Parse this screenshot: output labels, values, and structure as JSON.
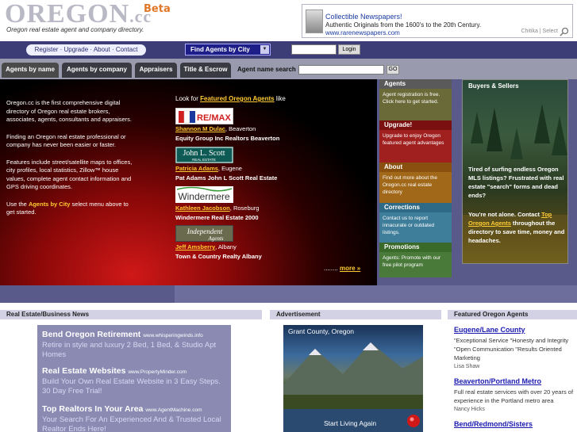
{
  "header": {
    "logo_main": "OREGON",
    "logo_cc": ".cc",
    "beta": "Beta",
    "tagline": "Oregon real estate agent and company directory."
  },
  "top_ad": {
    "title": "Collectible Newspapers!",
    "line": "Authentic Originals from the 1600's to the 20th Century.",
    "url": "www.rarenewspapers.com",
    "chitika": "Chitika | Select"
  },
  "nav": {
    "register": "Register",
    "upgrade": "Upgrade",
    "about": "About",
    "contact": "Contact",
    "sep": " · ",
    "city_select": "Find Agents by City",
    "login_btn": "Login"
  },
  "tabs": {
    "by_name": "Agents by name",
    "by_company": "Agents by company",
    "appraisers": "Appraisers",
    "title_escrow": "Title & Escrow",
    "search_label": "Agent name search",
    "go": "GO"
  },
  "hero": {
    "p1": "Oregon.cc is the first comprehensive digital directory of Oregon real estate brokers, associates, agents, consultants and appraisers.",
    "p2": "Finding an Oregon real estate professional or company has never been easier or faster.",
    "p3": "Features include street/satellite maps to offices, city profiles, local statistics, Zillow™ house values, complete agent contact information and GPS driving coordinates.",
    "p4_pre": "Use the ",
    "p4_hl": "Agents by City",
    "p4_post": " select menu above to get started.",
    "featured_pre": "Look for ",
    "featured_link": "Featured Oregon Agents",
    "featured_post": " like",
    "more_dots": "........ ",
    "more": "more »",
    "agents": [
      {
        "logo": "RE/MAX",
        "name": "Shannon M Dulac",
        "city": ", Beaverton",
        "company": "Equity Group Inc Realtors Beaverton"
      },
      {
        "logo": "John L. Scott",
        "logo_sub": "REAL ESTATE",
        "name": "Patricia Adams",
        "city": ", Eugene",
        "company": "Pat Adams John L Scott Real Estate"
      },
      {
        "logo": "Windermere",
        "name": "Kathleen Jacobson",
        "city": ", Roseburg",
        "company": "Windermere Real Estate 2000"
      },
      {
        "logo": "Independent Agents",
        "name": "Jeff Amsberry",
        "city": ", Albany",
        "company": "Town & Country Realty Albany"
      }
    ]
  },
  "menu": {
    "agents_head": "Agents",
    "agents_body": "Agent registration is free. Click here to get started.",
    "upgrade_head": "Upgrade!",
    "upgrade_body": "Upgrade to enjoy Oregon featured agent advantages",
    "about_head": "About",
    "about_body": "Find out more about the Oregon.cc real estate directory",
    "corrections_head": "Corrections",
    "corrections_body": "Contact us to report innacurate or outdated listings.",
    "promotions_head": "Promotions",
    "promotions_body": "Agents: Promote with our free pilot program"
  },
  "buyers": {
    "title": "Buyers & Sellers",
    "p1": "Tired of surfing endless Oregon MLS listings? Frustrated with real estate \"search\" forms and dead ends?",
    "p2_pre": "You're not alone. Contact ",
    "p2_link": "Top Oregon Agents",
    "p2_post": " throughout the directory to save time, money and headaches."
  },
  "news": {
    "head": "Real Estate/Business News",
    "items": [
      {
        "title": "Bend Oregon Retirement",
        "url": "www.whisperingwinds.info",
        "desc": "Retire in style and luxury 2 Bed, 1 Bed, & Studio Apt Homes"
      },
      {
        "title": "Real Estate Websites",
        "url": "www.PropertyMinder.com",
        "desc": "Build Your Own Real Estate Website in 3 Easy Steps. 30 Day Free Trial!"
      },
      {
        "title": "Top Realtors In Your Area",
        "url": "www.AgentMachine.com",
        "desc": "Your Search For An Experienced And & Trusted Local Realtor Ends Here!"
      }
    ]
  },
  "advert": {
    "head": "Advertisement",
    "caption": "Grant County, Oregon",
    "tag": "Start Living Again"
  },
  "featured": {
    "head": "Featured Oregon Agents",
    "items": [
      {
        "link": "Eugene/Lane County",
        "desc": "\"Exceptional Service \"Honesty and Integrity \"Open Communication \"Results Oriented Marketing",
        "person": "Lisa Shaw"
      },
      {
        "link": "Beaverton/Portland Metro",
        "desc": "Full real estate services with over 20 years of experience in the Portland metro area",
        "person": "Nancy Hicks"
      },
      {
        "link": "Bend/Redmond/Sisters",
        "desc": "",
        "person": ""
      }
    ]
  },
  "colors": {
    "nav_bg": "#3c3c76",
    "tab_bar": "#9a9aae",
    "band": "#5a5a8a",
    "accent_yellow": "#ffcc33",
    "logo_gray": "#b9b9c6",
    "beta_orange": "#e07828",
    "menu_agents": "#6a6a38",
    "menu_upgrade": "#a02020",
    "menu_about": "#a06818",
    "menu_corrections": "#3e7e9a",
    "menu_promotions": "#4a7a3a"
  }
}
